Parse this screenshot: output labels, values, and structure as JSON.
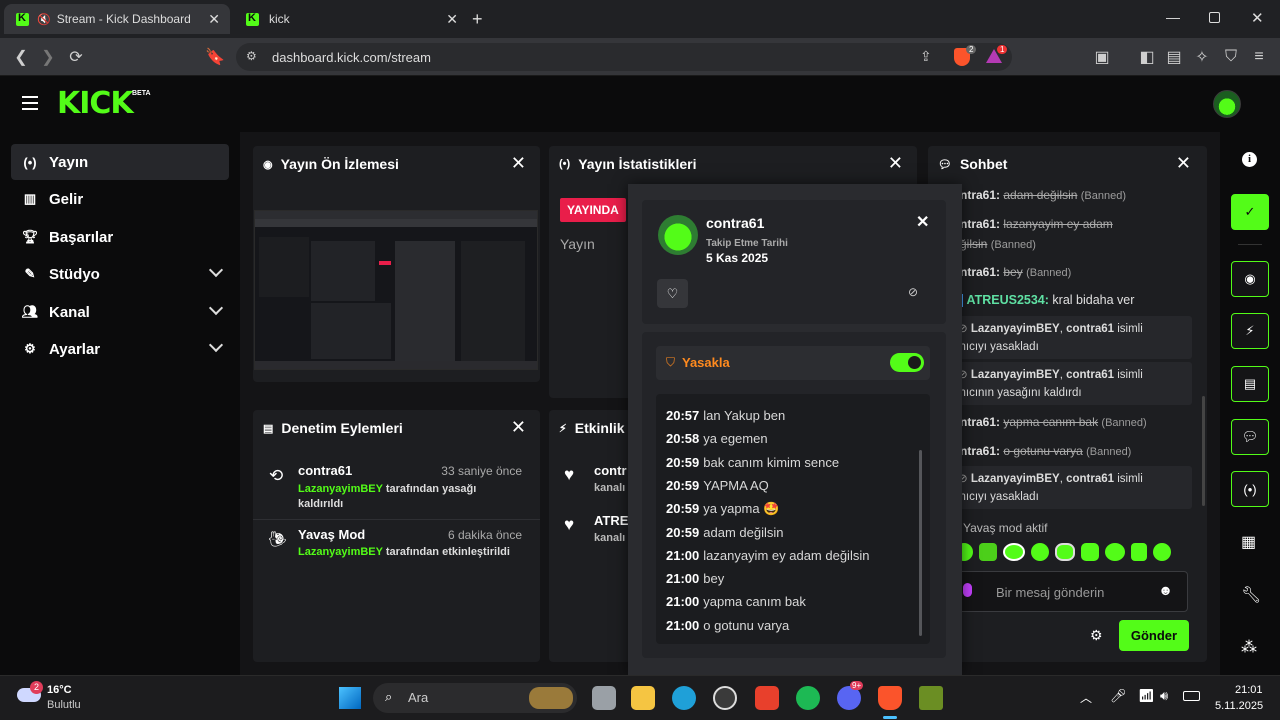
{
  "browser": {
    "tabs": [
      {
        "title": "Stream - Kick Dashboard"
      },
      {
        "title": "kick"
      }
    ],
    "url": "dashboard.kick.com/stream",
    "brave_badge": "2",
    "rewards_badge": "1"
  },
  "app": {
    "logo": "KICK",
    "logo_tag": "BETA"
  },
  "sidebar": {
    "items": [
      {
        "label": "Yayın",
        "icon": "broadcast-icon"
      },
      {
        "label": "Gelir",
        "icon": "revenue-icon"
      },
      {
        "label": "Başarılar",
        "icon": "trophy-icon"
      },
      {
        "label": "Stüdyo",
        "icon": "studio-icon"
      },
      {
        "label": "Kanal",
        "icon": "channel-icon"
      },
      {
        "label": "Ayarlar",
        "icon": "gear-icon"
      }
    ]
  },
  "panels": {
    "preview": {
      "title": "Yayın Ön İzlemesi"
    },
    "stats": {
      "title": "Yayın İstatistikleri",
      "live_badge": "YAYINDA",
      "label": "Yayın"
    },
    "moderation": {
      "title": "Denetim Eylemleri",
      "items": [
        {
          "name": "contra61",
          "time": "33 saniye önce",
          "actor": "LazanyayimBEY",
          "text1": " tarafından yasağı",
          "text2": "kaldırıldı"
        },
        {
          "name": "Yavaş Mod",
          "time": "6 dakika önce",
          "actor": "LazanyayimBEY",
          "text1": " tarafından etkinleştirildi",
          "text2": ""
        }
      ]
    },
    "activity": {
      "title": "Etkinlik",
      "items": [
        {
          "name": "contr",
          "sub": "kanalı"
        },
        {
          "name": "ATRE",
          "sub": "kanalı"
        }
      ]
    }
  },
  "chat": {
    "title": "Sohbet",
    "lines": [
      {
        "user": "ntra61:",
        "msg": "adam değilsin",
        "tag": "(Banned)"
      },
      {
        "user": "ntra61:",
        "msg": "lazanyayim ey adam",
        "tag": ""
      },
      {
        "user": "",
        "msg": "ğilsin",
        "tag": "(Banned)"
      },
      {
        "user": "ntra61:",
        "msg": "bey",
        "tag": "(Banned)"
      },
      {
        "user": "ATREUS2534:",
        "msg": "kral bidaha ver",
        "tag": ""
      },
      {
        "user": "ntra61:",
        "msg": "yapma canım bak",
        "tag": "(Banned)"
      },
      {
        "user": "ntra61:",
        "msg": "o gotunu varya",
        "tag": "(Banned)"
      }
    ],
    "system": [
      {
        "line1a": "LazanyayimBEY",
        "line1b": ", ",
        "line1c": "contra61",
        "line1d": " isimli",
        "line2": "llanıcıyı yasakladı"
      },
      {
        "line1a": "LazanyayimBEY",
        "line1b": ", ",
        "line1c": "contra61",
        "line1d": " isimli",
        "line2": "llanıcının yasağını kaldırdı"
      },
      {
        "line1a": "LazanyayimBEY",
        "line1b": ", ",
        "line1c": "contra61",
        "line1d": " isimli",
        "line2": "llanıcıyı yasakladı"
      }
    ],
    "slow_mode": "Yavaş mod aktif",
    "input_placeholder": "Bir mesaj gönderin",
    "send_label": "Gönder"
  },
  "popup": {
    "username": "contra61",
    "follow_label": "Takip Etme Tarihi",
    "follow_date": "5 Kas 2025",
    "ban_label": "Yasakla",
    "ban_enabled": true,
    "messages": [
      {
        "time": "20:57",
        "text": "lan Yakup ben"
      },
      {
        "time": "20:58",
        "text": "ya egemen"
      },
      {
        "time": "20:59",
        "text": "bak canım kimim sence"
      },
      {
        "time": "20:59",
        "text": "YAPMA AQ"
      },
      {
        "time": "20:59",
        "text": "ya yapma 🤩"
      },
      {
        "time": "20:59",
        "text": "adam değilsin"
      },
      {
        "time": "21:00",
        "text": "lazanyayim ey adam değilsin"
      },
      {
        "time": "21:00",
        "text": "bey"
      },
      {
        "time": "21:00",
        "text": "yapma canım bak"
      },
      {
        "time": "21:00",
        "text": "o gotunu varya"
      }
    ]
  },
  "taskbar": {
    "weather_temp": "16°C",
    "weather_desc": "Bulutlu",
    "weather_badge": "2",
    "search_placeholder": "Ara",
    "discord_badge": "9+",
    "time": "21:01",
    "date": "5.11.2025"
  },
  "colors": {
    "accent": "#53fc18",
    "live": "#e91e4a",
    "ban": "#ff8a1e"
  }
}
